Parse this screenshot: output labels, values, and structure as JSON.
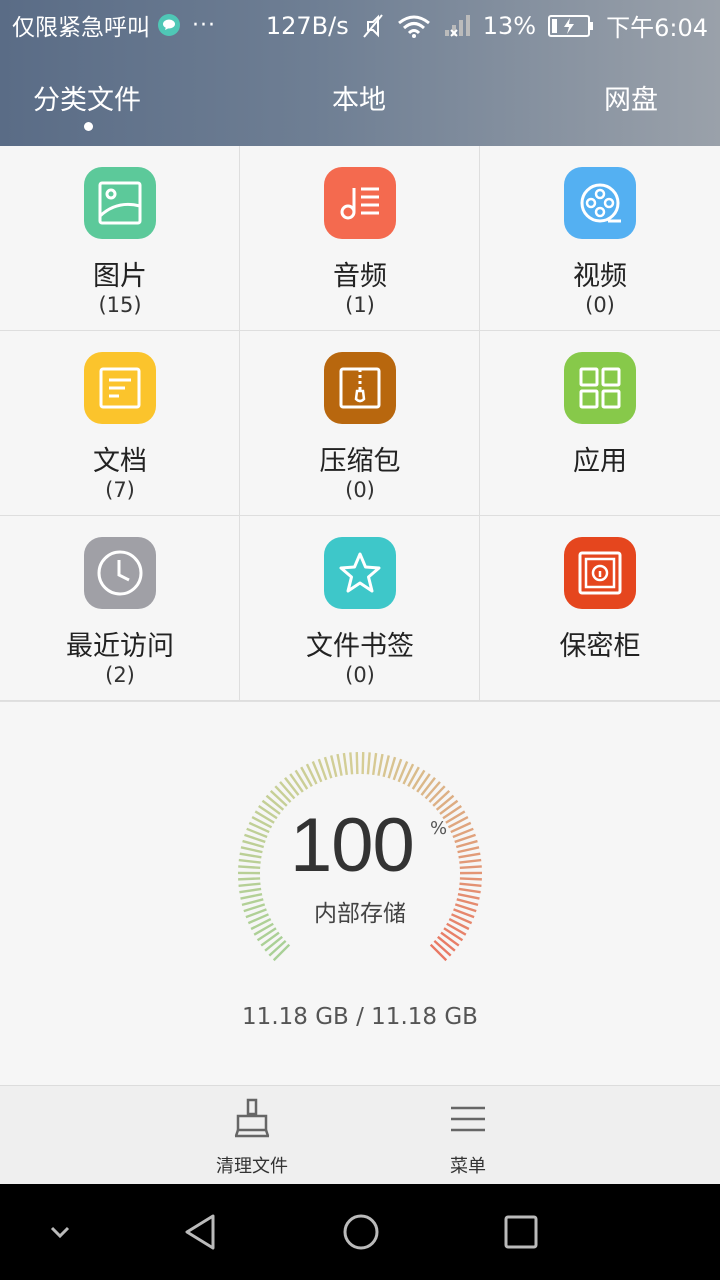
{
  "status_bar": {
    "carrier": "仅限紧急呼叫",
    "dots": "···",
    "net_speed": "127B/s",
    "battery": "13%",
    "time": "下午6:04"
  },
  "tabs": [
    {
      "label": "分类文件",
      "active": true
    },
    {
      "label": "本地",
      "active": false
    },
    {
      "label": "网盘",
      "active": false
    }
  ],
  "categories": [
    {
      "label": "图片",
      "count": "(15)",
      "color": "#5cc99a",
      "icon": "image-icon"
    },
    {
      "label": "音频",
      "count": "(1)",
      "color": "#f46a4f",
      "icon": "music-icon"
    },
    {
      "label": "视频",
      "count": "(0)",
      "color": "#54b0f2",
      "icon": "video-icon"
    },
    {
      "label": "文档",
      "count": "(7)",
      "color": "#fbc42c",
      "icon": "document-icon"
    },
    {
      "label": "压缩包",
      "count": "(0)",
      "color": "#b8670e",
      "icon": "archive-icon"
    },
    {
      "label": "应用",
      "count": "",
      "color": "#87c94a",
      "icon": "apps-icon"
    },
    {
      "label": "最近访问",
      "count": "(2)",
      "color": "#a0a0a6",
      "icon": "clock-icon"
    },
    {
      "label": "文件书签",
      "count": "(0)",
      "color": "#3ec7c9",
      "icon": "star-icon"
    },
    {
      "label": "保密柜",
      "count": "",
      "color": "#e5461e",
      "icon": "safe-icon"
    }
  ],
  "storage": {
    "percent": "100",
    "percent_symbol": "%",
    "label": "内部存储",
    "size": "11.18 GB / 11.18 GB",
    "used_fraction": 1.0
  },
  "toolbar": {
    "clean_label": "清理文件",
    "menu_label": "菜单"
  }
}
